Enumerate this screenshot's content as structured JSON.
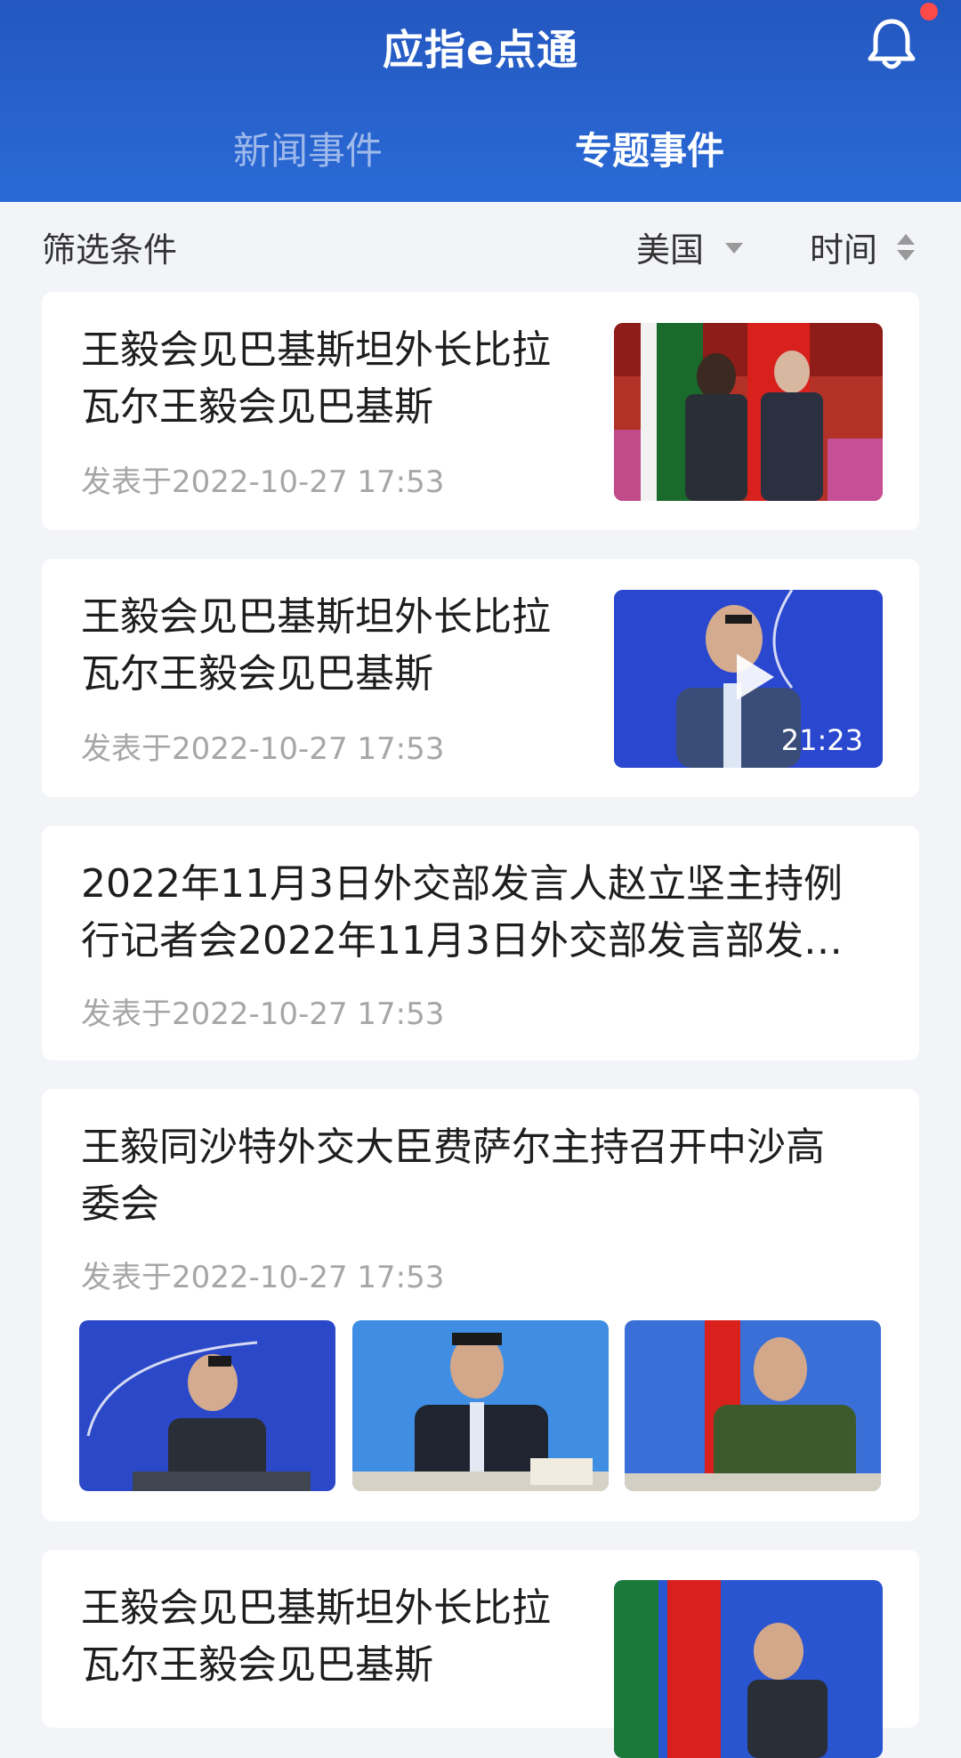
{
  "header": {
    "title": "应指e点通",
    "tabs": [
      {
        "label": "新闻事件",
        "active": false
      },
      {
        "label": "专题事件",
        "active": true
      }
    ],
    "bell_icon": "bell-icon",
    "has_notification_dot": true,
    "accent": "#2457c0"
  },
  "filter": {
    "label": "筛选条件",
    "country": "美国",
    "time": "时间"
  },
  "articles": [
    {
      "title_line1": "王毅会见巴基斯坦外长比拉",
      "title_line2": "瓦尔王毅会见巴基斯",
      "date": "发表于2022-10-27 17:53",
      "thumb_type": "image"
    },
    {
      "title_line1": "王毅会见巴基斯坦外长比拉",
      "title_line2": "瓦尔王毅会见巴基斯",
      "date": "发表于2022-10-27 17:53",
      "thumb_type": "video",
      "duration": "21:23"
    },
    {
      "title_line1": "2022年11月3日外交部发言人赵立坚主持例",
      "title_line2": "行记者会2022年11月3日外交部发言部发…",
      "date": "发表于2022-10-27 17:53",
      "thumb_type": "none"
    },
    {
      "title_line1": "王毅同沙特外交大臣费萨尔主持召开中沙高",
      "title_line2": "委会",
      "date": "发表于2022-10-27 17:53",
      "thumb_type": "gallery"
    },
    {
      "title_line1": "王毅会见巴基斯坦外长比拉",
      "title_line2": "瓦尔王毅会见巴基斯",
      "date": "",
      "thumb_type": "image"
    }
  ]
}
